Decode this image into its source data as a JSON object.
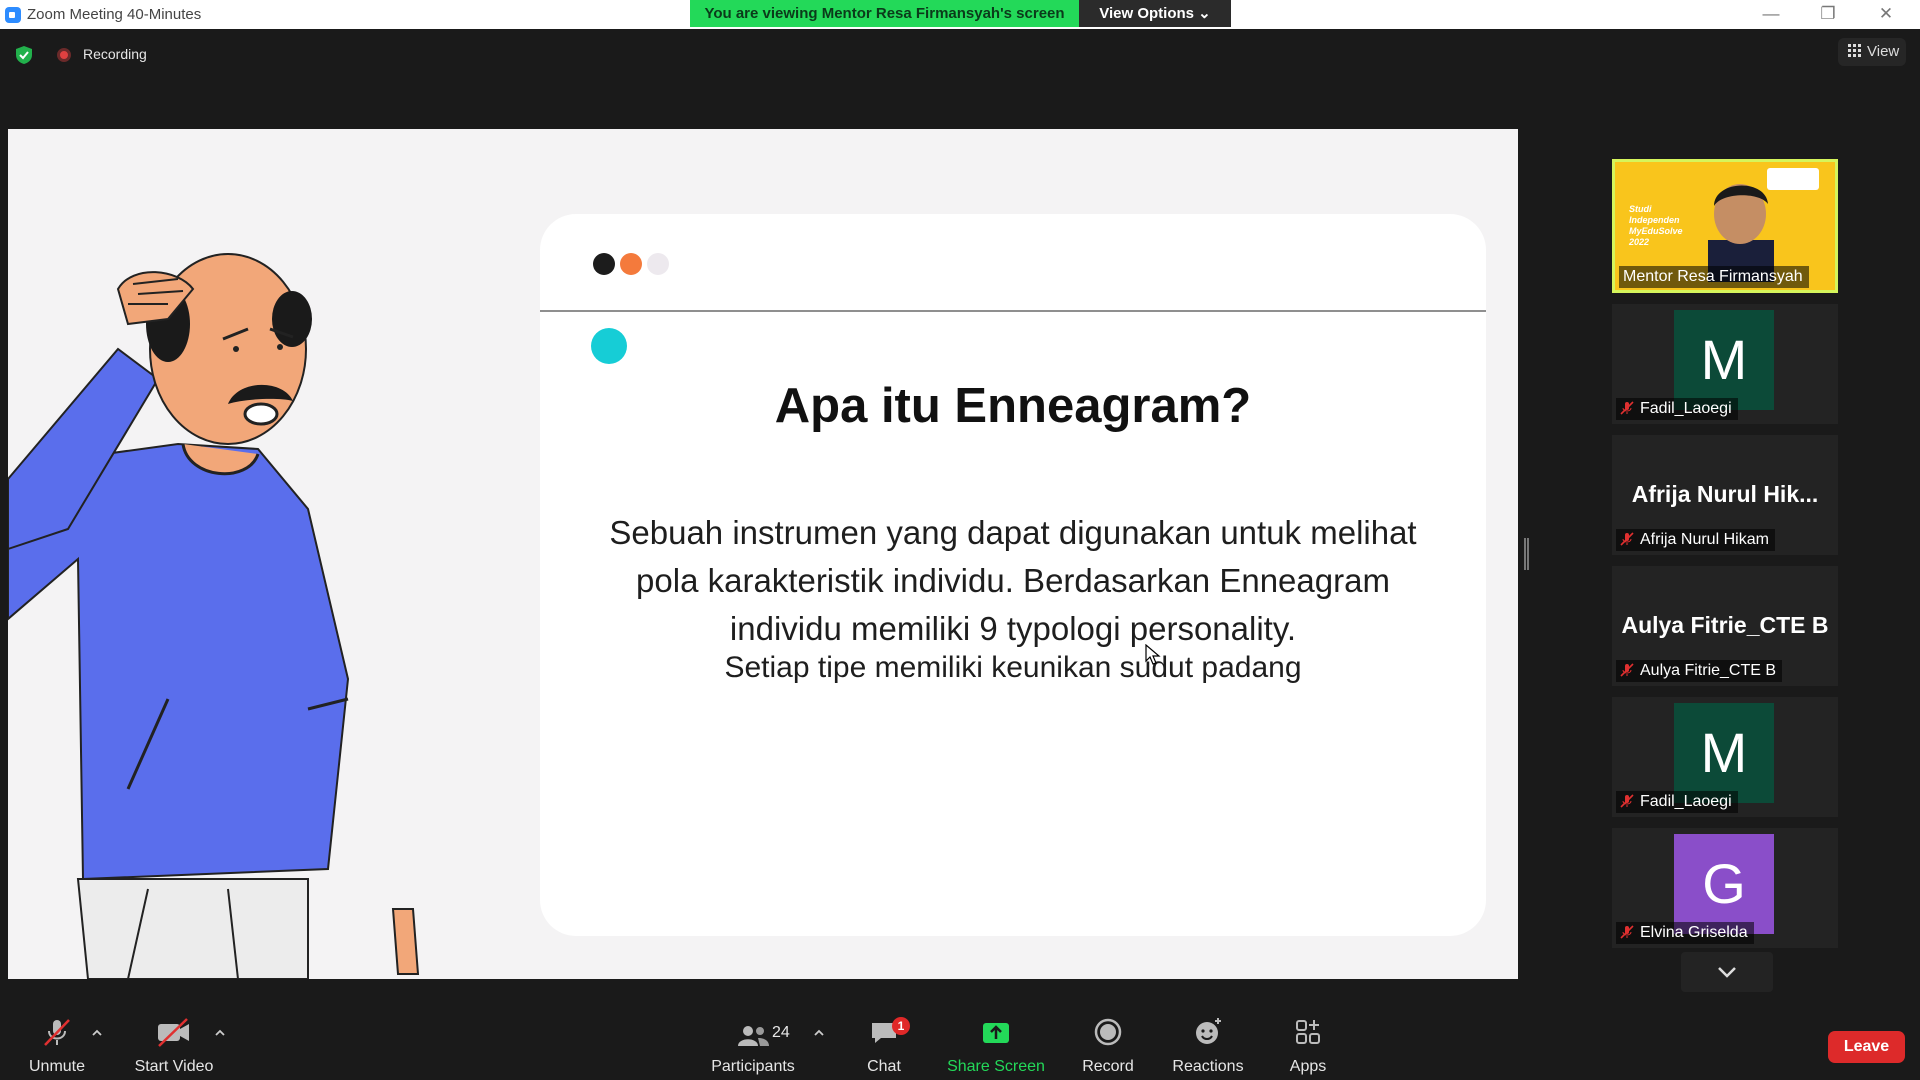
{
  "window": {
    "title": "Zoom Meeting 40-Minutes",
    "viewing_banner": "You are viewing Mentor Resa Firmansyah's screen",
    "view_options": "View Options ⌄",
    "minimize": "—",
    "restore": "❐",
    "close": "✕"
  },
  "meeting": {
    "recording_label": "Recording",
    "view_label": "View"
  },
  "slide": {
    "title": "Apa itu Enneagram?",
    "body_lines": [
      "Sebuah instrumen yang dapat digunakan untuk melihat",
      "pola karakteristik individu. Berdasarkan Enneagram",
      "individu memiliki 9 typologi personality."
    ],
    "body_extra": "Setiap tipe memiliki keunikan sudut padang",
    "dots_colors": [
      "#1c1c1c",
      "#f47a3c",
      "#ede9ee"
    ],
    "accent_dot_color": "#16cdd6"
  },
  "gallery": {
    "tiles": [
      {
        "type": "video",
        "name": "Mentor Resa Firmansyah",
        "brand_text": "Studi Independen MyEduSolve 2022",
        "muted": false
      },
      {
        "type": "avatar",
        "initial": "M",
        "avatar_color": "#0c4a38",
        "name": "Fadil_Laoegi",
        "muted": true
      },
      {
        "type": "text",
        "display": "Afrija Nurul Hik...",
        "name": "Afrija Nurul Hikam",
        "muted": true
      },
      {
        "type": "text",
        "display": "Aulya Fitrie_CTE B",
        "name": "Aulya Fitrie_CTE B",
        "muted": true
      },
      {
        "type": "avatar",
        "initial": "M",
        "avatar_color": "#0c4a38",
        "name": "Fadil_Laoegi",
        "muted": true
      },
      {
        "type": "avatar",
        "initial": "G",
        "avatar_color": "#8a4ec9",
        "name": "Elvina Griselda",
        "muted": true
      }
    ]
  },
  "toolbar": {
    "unmute": "Unmute",
    "start_video": "Start Video",
    "participants": "Participants",
    "participants_count": "24",
    "chat": "Chat",
    "chat_badge": "1",
    "share_screen": "Share Screen",
    "record": "Record",
    "reactions": "Reactions",
    "apps": "Apps",
    "leave": "Leave"
  }
}
